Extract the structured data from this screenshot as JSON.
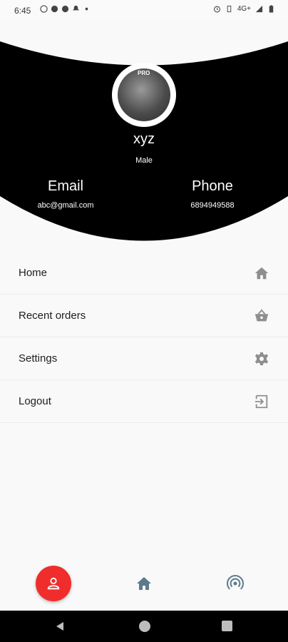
{
  "status_bar": {
    "time": "6:45",
    "network": "4G+"
  },
  "profile": {
    "avatar_tag": "PRO",
    "name": "xyz",
    "gender": "Male",
    "email_label": "Email",
    "email_value": "abc@gmail.com",
    "phone_label": "Phone",
    "phone_value": "6894949588"
  },
  "menu": {
    "items": [
      {
        "label": "Home",
        "icon": "home-icon"
      },
      {
        "label": "Recent orders",
        "icon": "basket-icon"
      },
      {
        "label": "Settings",
        "icon": "gear-icon"
      },
      {
        "label": "Logout",
        "icon": "logout-icon"
      }
    ]
  },
  "bottom_nav": {
    "items": [
      "profile-icon",
      "home-icon",
      "radar-icon"
    ],
    "active_color": "#f02d2d",
    "inactive_color": "#5d7a8c"
  },
  "colors": {
    "header_bg": "#000000",
    "accent": "#f02d2d",
    "icon_gray": "#8e8e8e"
  }
}
